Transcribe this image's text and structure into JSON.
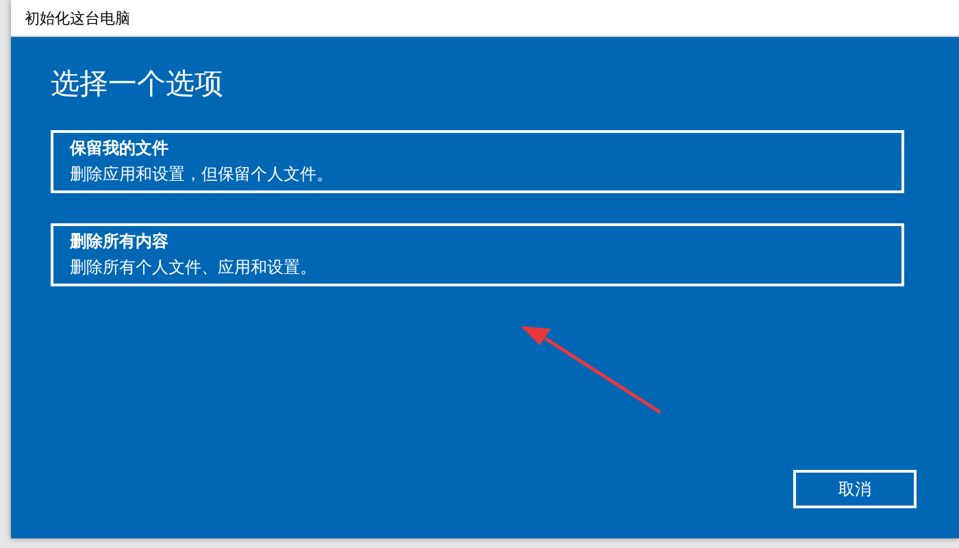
{
  "window": {
    "title": "初始化这台电脑"
  },
  "heading": "选择一个选项",
  "options": [
    {
      "title": "保留我的文件",
      "description": "删除应用和设置，但保留个人文件。"
    },
    {
      "title": "删除所有内容",
      "description": "删除所有个人文件、应用和设置。"
    }
  ],
  "buttons": [
    "取消"
  ]
}
